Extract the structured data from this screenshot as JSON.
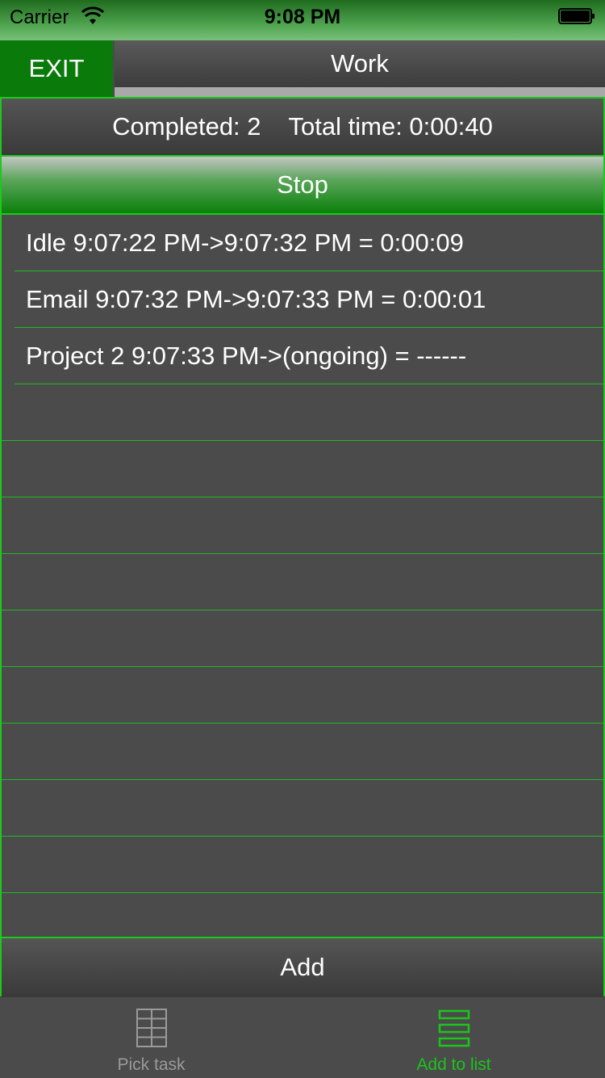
{
  "status_bar": {
    "carrier": "Carrier",
    "time": "9:08 PM"
  },
  "header": {
    "exit_label": "EXIT",
    "title": "Work"
  },
  "summary": {
    "completed": "Completed: 2",
    "total_time": "Total time: 0:00:40"
  },
  "stop_label": "Stop",
  "entries": [
    "Idle 9:07:22 PM->9:07:32 PM = 0:00:09",
    "Email 9:07:32 PM->9:07:33 PM = 0:00:01",
    "Project 2 9:07:33 PM->(ongoing) = ------"
  ],
  "add_label": "Add",
  "tabs": [
    {
      "label": "Pick task",
      "icon": "grid-icon",
      "selected": false
    },
    {
      "label": "Add to list",
      "icon": "list-icon",
      "selected": true
    }
  ],
  "colors": {
    "accent": "#1ec81e",
    "exit": "#0a7a0a",
    "background": "#4b4b4b"
  }
}
